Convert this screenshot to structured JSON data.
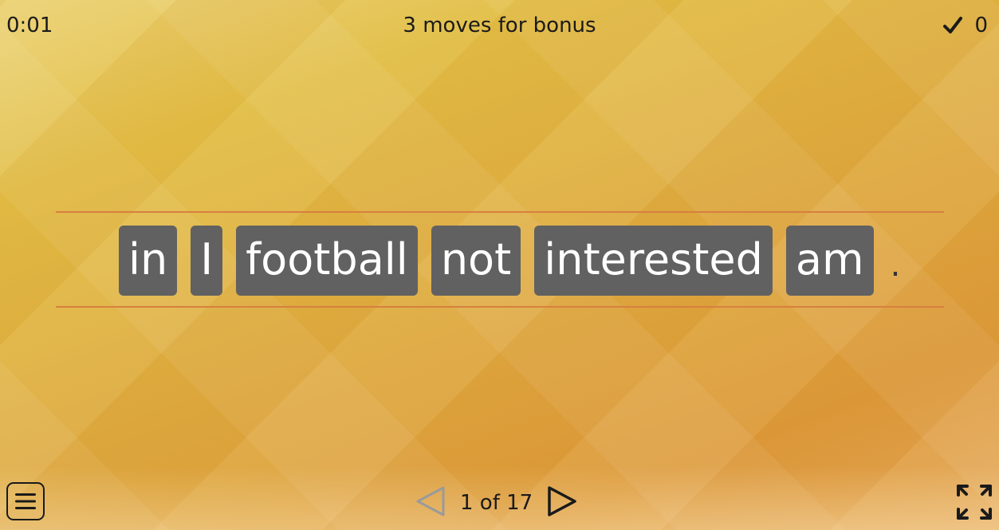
{
  "header": {
    "timer": "0:01",
    "bonus_text": "3 moves for bonus",
    "score": "0"
  },
  "sentence": {
    "words": [
      "in",
      "I",
      "football",
      "not",
      "interested",
      "am"
    ],
    "punctuation": "."
  },
  "footer": {
    "page_indicator": "1 of 17"
  },
  "icons": {
    "score": "check-icon",
    "menu": "menu-icon",
    "prev": "triangle-left-icon",
    "next": "triangle-right-icon",
    "fullscreen": "fullscreen-icon"
  },
  "colors": {
    "tile_bg": "#616161",
    "tile_text": "#ffffff",
    "rule_line": "#d7803f",
    "prev_disabled": "#9a9a9a"
  }
}
